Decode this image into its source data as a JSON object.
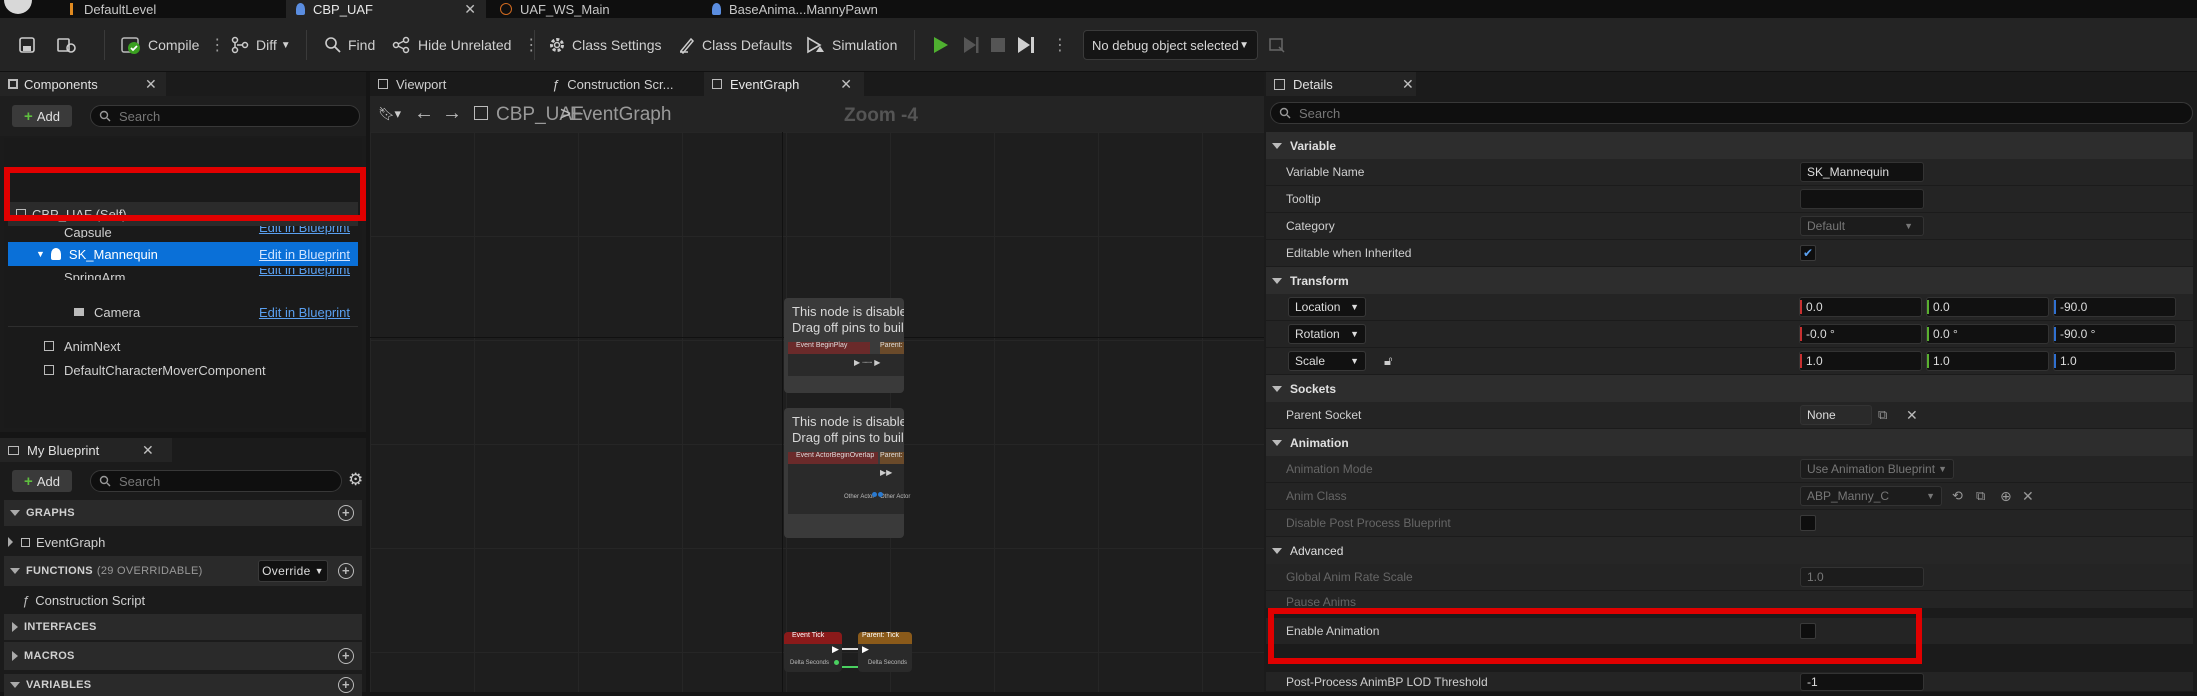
{
  "doc_tabs": [
    {
      "label": "DefaultLevel"
    },
    {
      "label": "CBP_UAF"
    },
    {
      "label": "UAF_WS_Main"
    },
    {
      "label": "BaseAnima...MannyPawn"
    }
  ],
  "toolbar": {
    "compile": "Compile",
    "diff": "Diff",
    "find": "Find",
    "hide_unrelated": "Hide Unrelated",
    "class_settings": "Class Settings",
    "class_defaults": "Class Defaults",
    "simulation": "Simulation",
    "debug_object": "No debug object selected"
  },
  "components": {
    "tab_label": "Components",
    "add_label": "Add",
    "search_placeholder": "Search",
    "items": [
      {
        "label": "CBP_UAF (Self)",
        "edit": ""
      },
      {
        "label": "Capsule",
        "edit": "Edit in Blueprint"
      },
      {
        "label": "SK_Mannequin",
        "edit": "Edit in Blueprint"
      },
      {
        "label": "SpringArm",
        "edit": "Edit in Blueprint"
      },
      {
        "label": "Camera",
        "edit": "Edit in Blueprint"
      },
      {
        "label": "AnimNext",
        "edit": ""
      },
      {
        "label": "DefaultCharacterMoverComponent",
        "edit": ""
      }
    ]
  },
  "my_blueprint": {
    "tab_label": "My Blueprint",
    "add_label": "Add",
    "search_placeholder": "Search",
    "graphs_label": "GRAPHS",
    "event_graph": "EventGraph",
    "functions_label": "FUNCTIONS",
    "functions_count": "(29 OVERRIDABLE)",
    "override_label": "Override",
    "construction_script": "Construction Script",
    "interfaces_label": "INTERFACES",
    "macros_label": "MACROS",
    "variables_label": "VARIABLES"
  },
  "graph": {
    "tabs": [
      "Viewport",
      "Construction Scr...",
      "EventGraph"
    ],
    "breadcrumb_root": "CBP_UAF",
    "breadcrumb_sep": ">",
    "breadcrumb_leaf": "EventGraph",
    "zoom": "Zoom -4",
    "disabled_line1": "This node is disabled and w",
    "disabled_line2": "Drag off pins to build funct",
    "node_labels": [
      "Event BeginPlay",
      "Parent: BeginPl",
      "Event ActorBeginOverlap",
      "Parent: ActorBe",
      "Event Tick",
      "Parent: Tick"
    ],
    "pin_labels": [
      "Other Actor",
      "Other Actor",
      "Delta Seconds",
      "Delta Seconds"
    ]
  },
  "details": {
    "tab_label": "Details",
    "search_placeholder": "Search",
    "sections": {
      "variable": "Variable",
      "transform": "Transform",
      "sockets": "Sockets",
      "animation": "Animation",
      "advanced": "Advanced"
    },
    "variable_name_label": "Variable Name",
    "variable_name_value": "SK_Mannequin",
    "tooltip_label": "Tooltip",
    "category_label": "Category",
    "category_value": "Default",
    "editable_label": "Editable when Inherited",
    "location_label": "Location",
    "location": [
      "0.0",
      "0.0",
      "-90.0"
    ],
    "rotation_label": "Rotation",
    "rotation": [
      "-0.0 °",
      "0.0 °",
      "-90.0 °"
    ],
    "scale_label": "Scale",
    "scale": [
      "1.0",
      "1.0",
      "1.0"
    ],
    "parent_socket_label": "Parent Socket",
    "parent_socket_value": "None",
    "animation_mode_label": "Animation Mode",
    "animation_mode_value": "Use Animation Blueprint",
    "anim_class_label": "Anim Class",
    "anim_class_value": "ABP_Manny_C",
    "disable_pp_label": "Disable Post Process Blueprint",
    "global_rate_label": "Global Anim Rate Scale",
    "global_rate_value": "1.0",
    "pause_anims_label": "Pause Anims",
    "enable_animation_label": "Enable Animation",
    "post_process_lod_label": "Post-Process AnimBP LOD Threshold",
    "post_process_lod_value": "-1"
  },
  "colors": {
    "selection": "#0a70d8",
    "highlight_box": "#e00000",
    "link": "#5aa0f0"
  }
}
